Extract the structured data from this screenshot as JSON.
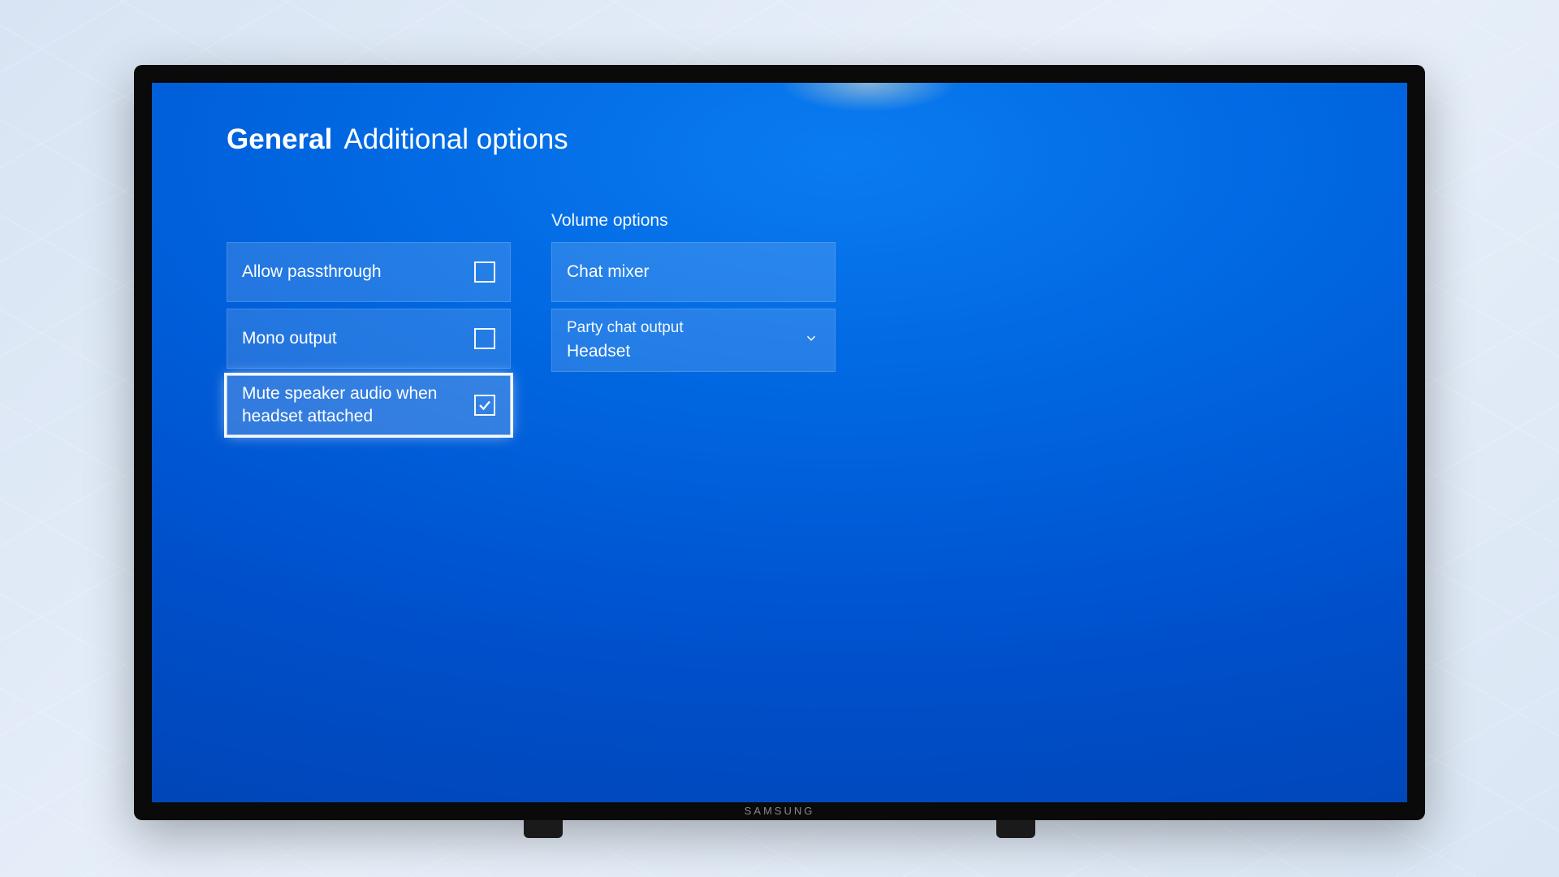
{
  "header": {
    "category": "General",
    "title": "Additional options"
  },
  "left_column": {
    "items": [
      {
        "label": "Allow passthrough",
        "checked": false,
        "selected": false
      },
      {
        "label": "Mono output",
        "checked": false,
        "selected": false
      },
      {
        "label": "Mute speaker audio when headset attached",
        "checked": true,
        "selected": true
      }
    ]
  },
  "right_column": {
    "heading": "Volume options",
    "chat_mixer": {
      "label": "Chat mixer"
    },
    "party_chat": {
      "label": "Party chat output",
      "value": "Headset"
    }
  },
  "tv_brand": "SAMSUNG"
}
